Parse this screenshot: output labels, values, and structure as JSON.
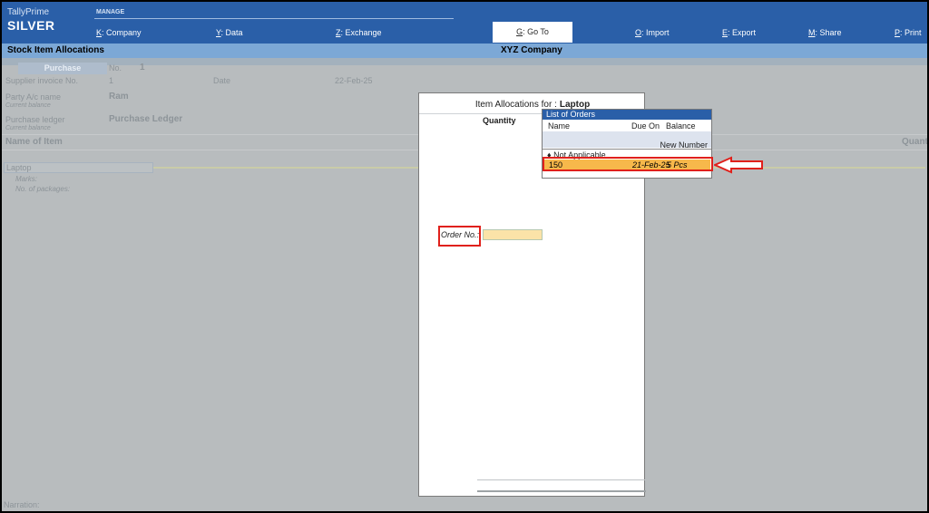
{
  "header": {
    "app_name": "TallyPrime",
    "edition": "SILVER",
    "section": "MANAGE",
    "menu": [
      {
        "key": "K",
        "label": ": Company"
      },
      {
        "key": "Y",
        "label": ": Data"
      },
      {
        "key": "Z",
        "label": ": Exchange"
      },
      {
        "key": "G",
        "label": ": Go To"
      },
      {
        "key": "O",
        "label": ": Import"
      },
      {
        "key": "E",
        "label": ": Export"
      },
      {
        "key": "M",
        "label": ": Share"
      },
      {
        "key": "P",
        "label": ": Print"
      }
    ]
  },
  "titlebar": {
    "screen": "Stock Item Allocations",
    "company": "XYZ Company"
  },
  "background_form": {
    "voucher_type": "Purchase",
    "no_label": "No.",
    "no_value": "1",
    "supplier_invoice_label": "Supplier invoice No.",
    "supplier_invoice_value": "1",
    "date_label": "Date",
    "date_value": "22-Feb-25",
    "party_label": "Party A/c name",
    "party_value": "Ram",
    "current_balance_label": "Current balance",
    "purchase_ledger_label": "Purchase ledger",
    "purchase_ledger_value": "Purchase Ledger",
    "name_of_item": "Name of Item",
    "quantity_col": "Quantity",
    "item": "Laptop",
    "item_sub1": "Marks:",
    "item_sub2": "No. of packages:",
    "narration": "Narration:"
  },
  "modal": {
    "title_prefix": "Item Allocations for :",
    "title_item": "Laptop",
    "quantity_header": "Quantity",
    "order_label": "Order No.:",
    "order_value": ""
  },
  "popup": {
    "title": "List of Orders",
    "col_name": "Name",
    "col_due_on": "Due On",
    "col_balance": "Balance",
    "new_number": "New Number",
    "not_applicable": "♦ Not Applicable",
    "orders": [
      {
        "name": "150",
        "due_on": "21-Feb-25",
        "balance": "5 Pcs"
      }
    ]
  },
  "colors": {
    "header_bg": "#2a5fa8",
    "titlebar_bg": "#7ca8d6",
    "highlight_row": "#f7b84b",
    "annotation_red": "#e0201b"
  }
}
